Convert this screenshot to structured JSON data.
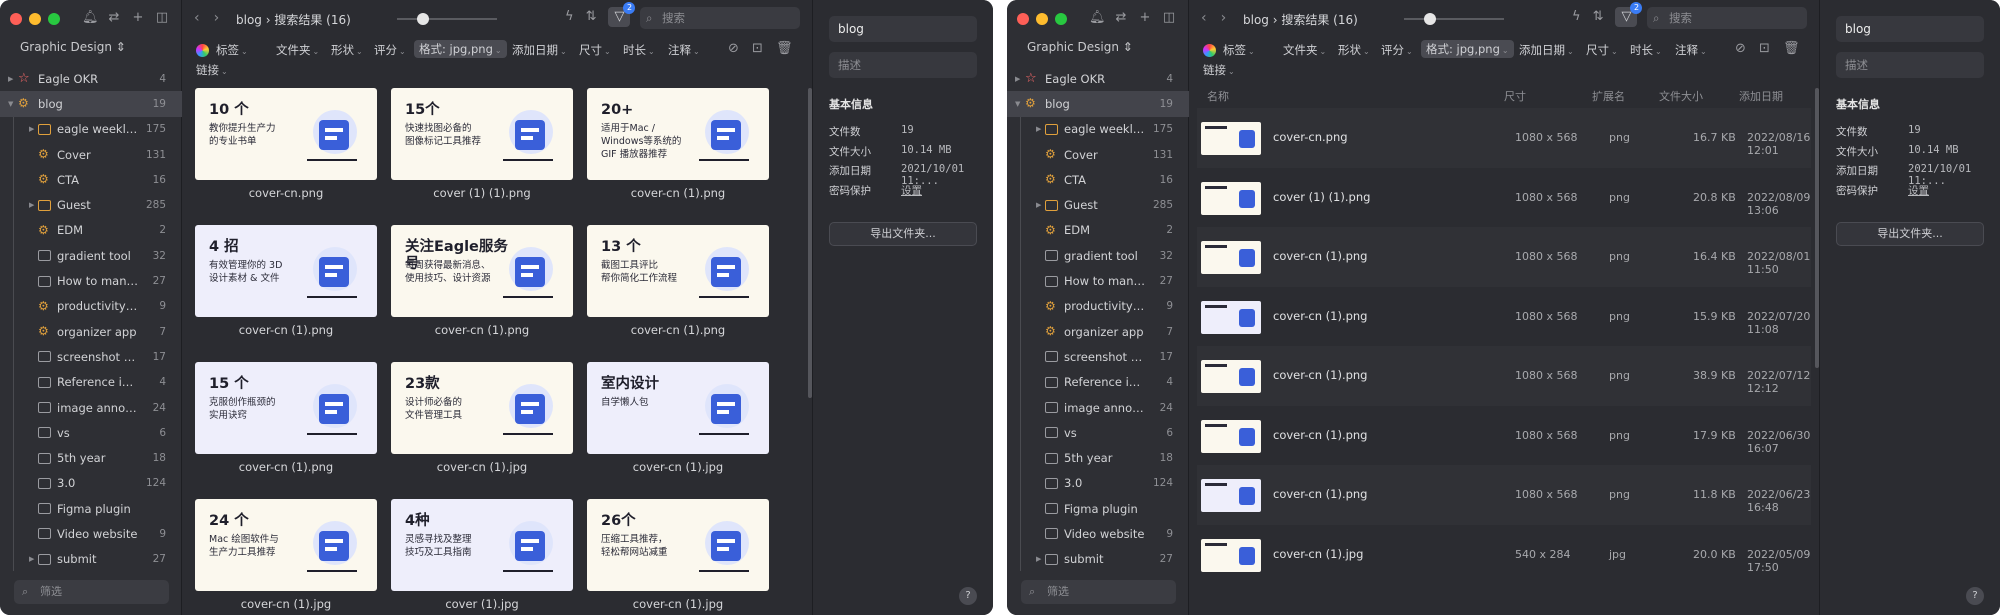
{
  "sidebar": {
    "library_name": "Graphic Design ⇕",
    "filter_placeholder": "筛选",
    "items": [
      {
        "label": "Eagle OKR",
        "count": "4",
        "icon": "star",
        "level": "top",
        "arrow": true
      },
      {
        "label": "blog",
        "count": "19",
        "icon": "gear",
        "level": "top",
        "arrow": true,
        "selected": true
      },
      {
        "label": "eagle weekly...",
        "count": "175",
        "icon": "box",
        "level": "sub",
        "arrow": true
      },
      {
        "label": "Cover",
        "count": "131",
        "icon": "gear",
        "level": "sub"
      },
      {
        "label": "CTA",
        "count": "16",
        "icon": "gear",
        "level": "sub"
      },
      {
        "label": "Guest",
        "count": "285",
        "icon": "box",
        "level": "sub",
        "arrow": true
      },
      {
        "label": "EDM",
        "count": "2",
        "icon": "gear",
        "level": "sub"
      },
      {
        "label": "gradient tool",
        "count": "32",
        "icon": "folder",
        "level": "sub"
      },
      {
        "label": "How to mana...",
        "count": "27",
        "icon": "folder",
        "level": "sub"
      },
      {
        "label": "productivity ...",
        "count": "9",
        "icon": "gear",
        "level": "sub"
      },
      {
        "label": "organizer app",
        "count": "7",
        "icon": "gear",
        "level": "sub"
      },
      {
        "label": "screenshot a...",
        "count": "17",
        "icon": "folder",
        "level": "sub"
      },
      {
        "label": "Reference im...",
        "count": "4",
        "icon": "folder",
        "level": "sub"
      },
      {
        "label": "image annot...",
        "count": "24",
        "icon": "folder",
        "level": "sub"
      },
      {
        "label": "vs",
        "count": "6",
        "icon": "folder",
        "level": "sub"
      },
      {
        "label": "5th year",
        "count": "18",
        "icon": "folder",
        "level": "sub"
      },
      {
        "label": "3.0",
        "count": "124",
        "icon": "folder",
        "level": "sub"
      },
      {
        "label": "Figma plugin",
        "count": "",
        "icon": "folder",
        "level": "sub"
      },
      {
        "label": "Video website",
        "count": "9",
        "icon": "folder",
        "level": "sub"
      },
      {
        "label": "submit",
        "count": "27",
        "icon": "folder",
        "level": "sub",
        "arrow": true
      }
    ]
  },
  "toolbar": {
    "breadcrumb": "blog › 搜索结果 (16)",
    "filter_badge": "2",
    "search_placeholder": "搜索"
  },
  "filters": {
    "tag": "标签",
    "folder": "文件夹",
    "shape": "形状",
    "rating": "评分",
    "format": "格式: jpg,png",
    "date": "添加日期",
    "size": "尺寸",
    "duration": "时长",
    "note": "注释",
    "link": "链接"
  },
  "grid_items": [
    {
      "name": "cover-cn.png",
      "title": "10 个",
      "sub": "教你提升生产力\n的专业书单",
      "bg": "cream"
    },
    {
      "name": "cover (1) (1).png",
      "title": "15个",
      "sub": "快速找图必备的\n图像标记工具推荐",
      "bg": "cream"
    },
    {
      "name": "cover-cn (1).png",
      "title": "20+",
      "sub": "适用于Mac /\nWindows等系统的\nGIF 播放器推荐",
      "bg": "cream"
    },
    {
      "name": "cover-cn (1).png",
      "title": "4 招",
      "sub": "有效管理你的 3D\n设计素材 & 文件",
      "bg": "lav"
    },
    {
      "name": "cover-cn (1).png",
      "title": "关注Eagle服务号",
      "sub": "每周获得最新消息、\n使用技巧、设计资源",
      "bg": "cream"
    },
    {
      "name": "cover-cn (1).png",
      "title": "13 个",
      "sub": "截图工具评比\n帮你简化工作流程",
      "bg": "cream"
    },
    {
      "name": "cover-cn (1).png",
      "title": "15 个",
      "sub": "克服创作瓶颈的\n实用诀窍",
      "bg": "lav"
    },
    {
      "name": "cover-cn (1).jpg",
      "title": "23款",
      "sub": "设计师必备的\n文件管理工具",
      "bg": "cream"
    },
    {
      "name": "cover-cn (1).jpg",
      "title": "室内设计",
      "sub": "自学懒人包",
      "bg": "lav"
    },
    {
      "name": "cover-cn (1).jpg",
      "title": "24 个",
      "sub": "Mac 绘图软件与\n生产力工具推荐",
      "bg": "cream"
    },
    {
      "name": "cover (1).jpg",
      "title": "4种",
      "sub": "灵感寻找及整理\n技巧及工具指南",
      "bg": "lav"
    },
    {
      "name": "cover-cn (1).jpg",
      "title": "26个",
      "sub": "压缩工具推荐，\n轻松帮网站减重",
      "bg": "cream"
    }
  ],
  "list_header": {
    "name": "名称",
    "size": "尺寸",
    "ext": "扩展名",
    "filesize": "文件大小",
    "date": "添加日期"
  },
  "list_items": [
    {
      "name": "cover-cn.png",
      "dim": "1080 x 568",
      "ext": "png",
      "fsize": "16.7 KB",
      "date": "2022/08/16 12:01",
      "bg": "cream"
    },
    {
      "name": "cover (1) (1).png",
      "dim": "1080 x 568",
      "ext": "png",
      "fsize": "20.8 KB",
      "date": "2022/08/09 13:06",
      "bg": "cream"
    },
    {
      "name": "cover-cn (1).png",
      "dim": "1080 x 568",
      "ext": "png",
      "fsize": "16.4 KB",
      "date": "2022/08/01 11:50",
      "bg": "cream"
    },
    {
      "name": "cover-cn (1).png",
      "dim": "1080 x 568",
      "ext": "png",
      "fsize": "15.9 KB",
      "date": "2022/07/20 11:08",
      "bg": "lav"
    },
    {
      "name": "cover-cn (1).png",
      "dim": "1080 x 568",
      "ext": "png",
      "fsize": "38.9 KB",
      "date": "2022/07/12 12:12",
      "bg": "cream"
    },
    {
      "name": "cover-cn (1).png",
      "dim": "1080 x 568",
      "ext": "png",
      "fsize": "17.9 KB",
      "date": "2022/06/30 16:07",
      "bg": "cream"
    },
    {
      "name": "cover-cn (1).png",
      "dim": "1080 x 568",
      "ext": "png",
      "fsize": "11.8 KB",
      "date": "2022/06/23 16:48",
      "bg": "lav"
    },
    {
      "name": "cover-cn (1).jpg",
      "dim": "540 x 284",
      "ext": "jpg",
      "fsize": "20.0 KB",
      "date": "2022/05/09 17:50",
      "bg": "cream"
    }
  ],
  "inspector": {
    "name_value": "blog",
    "desc_placeholder": "描述",
    "section_title": "基本信息",
    "rows": [
      {
        "k": "文件数",
        "v": "19"
      },
      {
        "k": "文件大小",
        "v": "10.14 MB"
      },
      {
        "k": "添加日期",
        "v": "2021/10/01 11:..."
      },
      {
        "k": "密码保护",
        "v": "设置",
        "link": true
      }
    ],
    "export_label": "导出文件夹...",
    "help": "?"
  },
  "colors": {
    "window_bg": "#2b2c31",
    "accent": "#3a7cf5",
    "sidebar_selected": "#43444b"
  }
}
